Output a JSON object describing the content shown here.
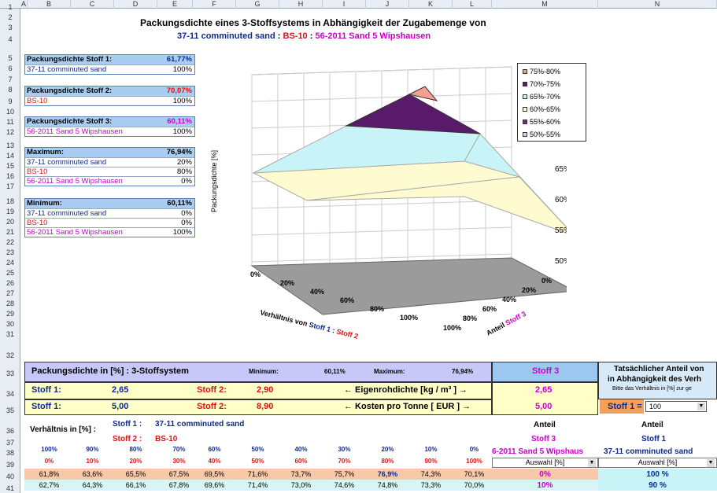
{
  "columns": [
    "A",
    "B",
    "C",
    "D",
    "E",
    "F",
    "G",
    "H",
    "I",
    "J",
    "K",
    "L",
    "M",
    "N"
  ],
  "rows": [
    "1",
    "2",
    "3",
    "4",
    "5",
    "6",
    "7",
    "8",
    "9",
    "10",
    "11",
    "12",
    "13",
    "14",
    "15",
    "16",
    "17",
    "18",
    "19",
    "20",
    "21",
    "22",
    "23",
    "24",
    "25",
    "26",
    "27",
    "28",
    "29",
    "30",
    "31",
    "32",
    "33",
    "34",
    "35",
    "36",
    "37",
    "38",
    "39",
    "40",
    "41"
  ],
  "title": "Packungsdichte eines 3-Stoffsystems in Abhängigkeit der Zugabemenge von",
  "subtitle": {
    "s1": "37-11 comminuted sand",
    "sep1": " : ",
    "s2": "BS-10",
    "sep2": " : ",
    "s3": "56-2011 Sand 5 Wipshausen"
  },
  "boxes": [
    {
      "head": "Packungsdichte Stoff 1:",
      "val": "61,77%",
      "vcolor": "blue",
      "row": "37-11 comminuted sand",
      "rv": "100%",
      "rcolor": "blue"
    },
    {
      "head": "Packungsdichte Stoff 2:",
      "val": "70,07%",
      "vcolor": "red",
      "row": "BS-10",
      "rv": "100%",
      "rcolor": "red"
    },
    {
      "head": "Packungsdichte Stoff 3:",
      "val": "60,11%",
      "vcolor": "mag",
      "row": "56-2011 Sand 5 Wipshausen",
      "rv": "100%",
      "rcolor": "mag"
    }
  ],
  "maximum": {
    "head": "Maximum:",
    "val": "76,94%",
    "rows": [
      [
        "37-11 comminuted sand",
        "20%"
      ],
      [
        "BS-10",
        "80%"
      ],
      [
        "56-2011 Sand 5 Wipshausen",
        "0%"
      ]
    ]
  },
  "minimum": {
    "head": "Minimum:",
    "val": "60,11%",
    "rows": [
      [
        "37-11 comminuted sand",
        "0%"
      ],
      [
        "BS-10",
        "0%"
      ],
      [
        "56-2011 Sand 5 Wipshausen",
        "100%"
      ]
    ]
  },
  "chart": {
    "legend": [
      "75%-80%",
      "70%-75%",
      "65%-70%",
      "60%-65%",
      "55%-60%",
      "50%-55%"
    ],
    "legend_colors": [
      "#f4a090",
      "#5a1a6a",
      "#c8f4f8",
      "#ffffd8",
      "#7a2a8a",
      "#c8d8f8"
    ],
    "zlabel": "Packungsdichte [%]",
    "zticks": [
      "65%",
      "60%",
      "55%",
      "50%"
    ],
    "xticks": [
      "0%",
      "20%",
      "40%",
      "60%",
      "80%",
      "100%"
    ],
    "yticks": [
      "0%",
      "20%",
      "40%",
      "60%",
      "80%",
      "100%"
    ],
    "xlabel_a": "Verhältnis von ",
    "xlabel_b": "Stoff 1",
    "xlabel_c": " : ",
    "xlabel_d": "Stoff 2",
    "ylabel_a": "Anteil ",
    "ylabel_b": "Stoff 3"
  },
  "lower": {
    "title": "Packungsdichte in [%] : 3-Stoffsystem",
    "min_l": "Minimum:",
    "min_v": "60,11%",
    "max_l": "Maximum:",
    "max_v": "76,94%",
    "stoff3": "Stoff 3",
    "rightA": "Tatsächlicher Anteil von",
    "rightB": "in Abhängigkeit des Verh",
    "rightC": "Bitte das Verhältnis in [%] zur ge",
    "s1l": "Stoff 1:",
    "s1v": "2,65",
    "s2l": "Stoff 2:",
    "s2v": "2,90",
    "eig": "← Eigenrohdichte [kg / m³ ] →",
    "s3v": "2,65",
    "k1l": "Stoff 1:",
    "k1v": "5,00",
    "k2l": "Stoff 2:",
    "k2v": "8,90",
    "kost": "← Kosten pro Tonne [ EUR ] →",
    "k3v": "5,00",
    "sel_label": "Stoff 1 =",
    "sel_value": "100",
    "verh": "Verhältnis in [%] :",
    "st1": "Stoff 1 :",
    "st1n": "37-11 comminuted sand",
    "st2": "Stoff 2 :",
    "st2n": "BS-10",
    "anteil": "Anteil",
    "m_st": "Stoff 3",
    "m_name": "6-2011 Sand 5 Wipshaus",
    "n_st": "Stoff 1",
    "n_name": "37-11 comminuted sand",
    "auswahl": "Auswahl [%]",
    "top_pct": [
      "100%",
      "90%",
      "80%",
      "70%",
      "60%",
      "50%",
      "40%",
      "30%",
      "20%",
      "10%",
      "0%"
    ],
    "bot_pct": [
      "0%",
      "10%",
      "20%",
      "30%",
      "40%",
      "50%",
      "60%",
      "70%",
      "80%",
      "90%",
      "100%"
    ],
    "r40": [
      "61,8%",
      "63,6%",
      "65,5%",
      "67,5%",
      "69,5%",
      "71,6%",
      "73,7%",
      "75,7%",
      "76,9%",
      "74,3%",
      "70,1%"
    ],
    "r41": [
      "62,7%",
      "64,3%",
      "66,1%",
      "67,8%",
      "69,6%",
      "71,4%",
      "73,0%",
      "74,6%",
      "74,8%",
      "73,3%",
      "70,0%"
    ],
    "m40": "0%",
    "m41": "10%",
    "n40": "100 %",
    "n41": "90 %"
  }
}
